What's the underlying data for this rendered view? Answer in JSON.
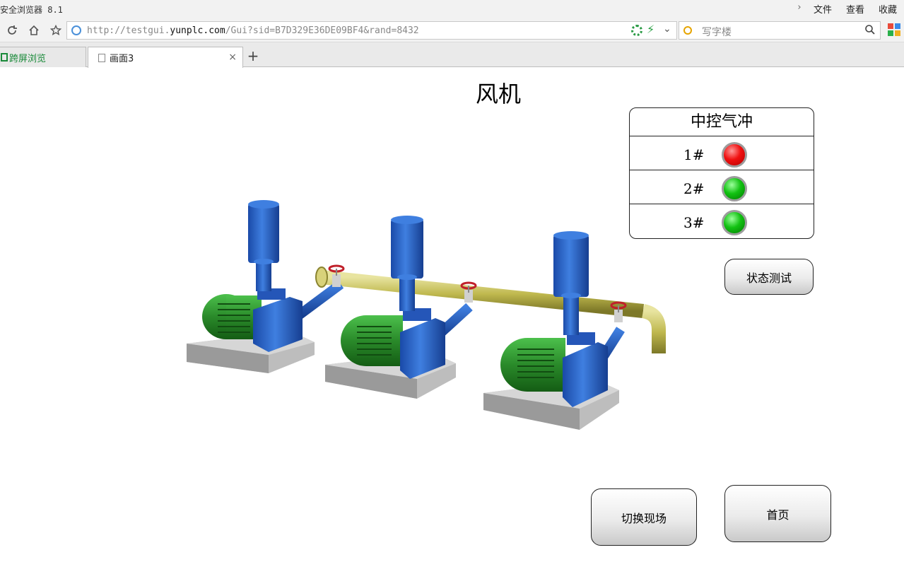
{
  "window": {
    "title": "安全浏览器 8.1",
    "menu": [
      "文件",
      "查看",
      "收藏"
    ]
  },
  "navbar": {
    "url_prefix": "http://testgui.",
    "url_domain": "yunplc.com",
    "url_suffix": "/Gui?sid=B7D329E36DE09BF4&rand=8432",
    "search_placeholder": "写字楼"
  },
  "tabs": [
    {
      "label": "跨屏浏览"
    },
    {
      "label": "画面3",
      "active": true
    }
  ],
  "hmi": {
    "title": "风机",
    "status_panel": {
      "header": "中控气冲",
      "rows": [
        {
          "label": "1#",
          "state": "red"
        },
        {
          "label": "2#",
          "state": "green"
        },
        {
          "label": "3#",
          "state": "green"
        }
      ]
    },
    "buttons": {
      "test": "状态测试",
      "switch": "切换现场",
      "home": "首页"
    }
  },
  "colors": {
    "motor_green": "#2f9a2f",
    "pump_blue": "#1f5fc0",
    "pipe_yellow": "#c8c25a",
    "valve_red": "#c0202a",
    "base_gray": "#c9c9c9"
  }
}
